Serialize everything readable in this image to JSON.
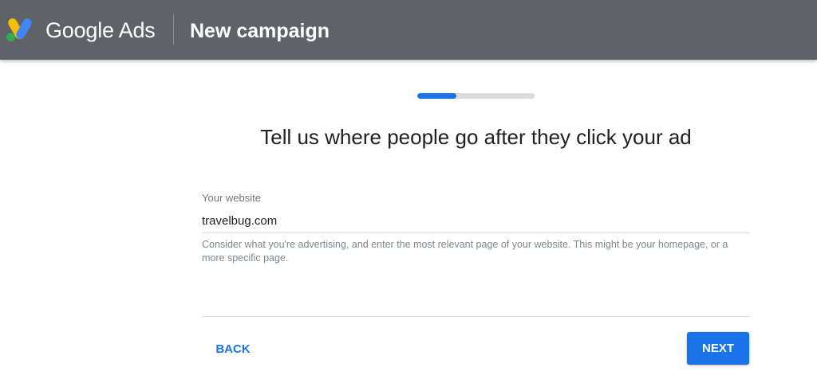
{
  "header": {
    "brand": "Google Ads",
    "title": "New campaign",
    "logo_icon": "google-ads-logo",
    "background_color": "#5f6368"
  },
  "progress": {
    "fraction": 0.33,
    "fill_color": "#1a73e8",
    "track_color": "#dadce0"
  },
  "main": {
    "heading": "Tell us where people go after they click your ad",
    "website_field": {
      "label": "Your website",
      "value": "travelbug.com"
    },
    "helper_text": "Consider what you're advertising, and enter the most relevant page of your website. This might be your homepage, or a more specific page."
  },
  "footer": {
    "back_label": "BACK",
    "next_label": "NEXT",
    "accent_color": "#1a73e8"
  }
}
